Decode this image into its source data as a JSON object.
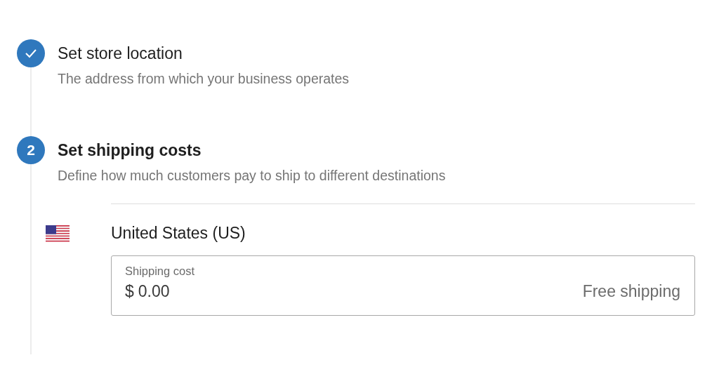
{
  "steps": [
    {
      "kind": "done",
      "title": "Set store location",
      "description": "The address from which your business operates"
    },
    {
      "kind": "active",
      "number": "2",
      "title": "Set shipping costs",
      "description": "Define how much customers pay to ship to different destinations",
      "destinations": [
        {
          "country": "United States (US)",
          "field": {
            "label": "Shipping cost",
            "currency": "$",
            "value": "0.00",
            "suffix": "Free shipping"
          }
        }
      ]
    }
  ]
}
